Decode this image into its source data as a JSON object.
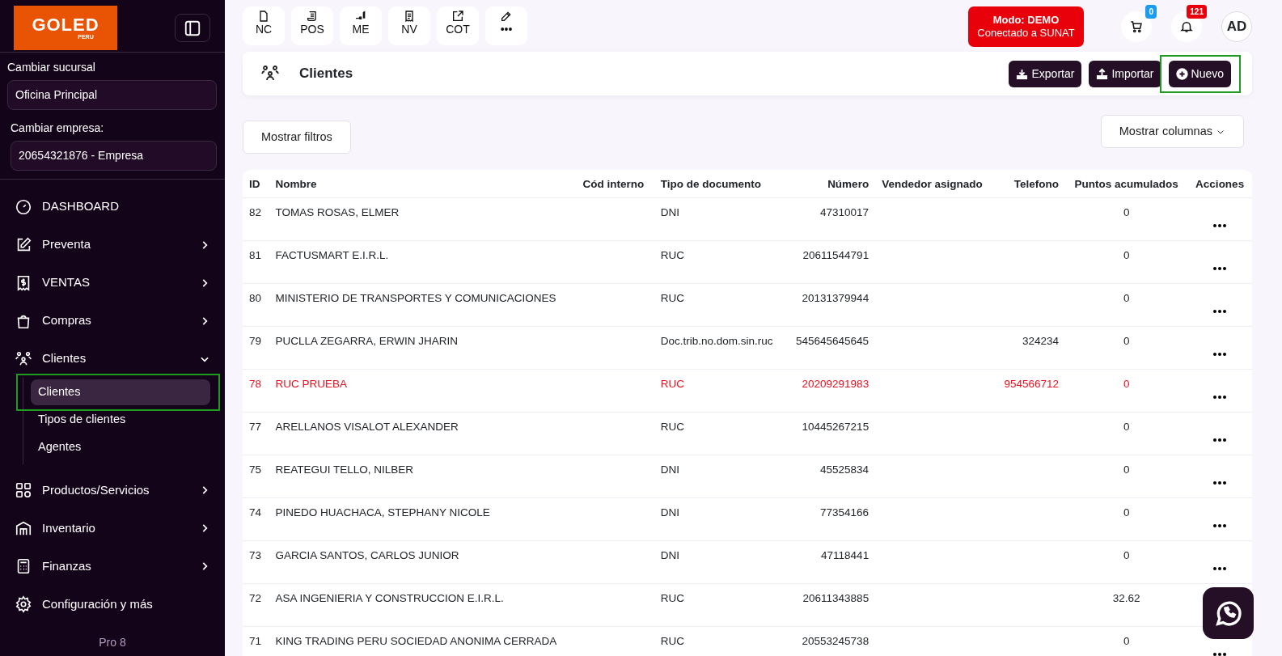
{
  "sidebar": {
    "logo": "GOLED",
    "logo_sub": "PERU",
    "branch_label": "Cambiar sucursal",
    "branch": "Oficina Principal",
    "company_label": "Cambiar empresa:",
    "company": "20654321876 - Empresa",
    "menu": [
      {
        "label": "DASHBOARD",
        "kind": "link"
      },
      {
        "label": "Preventa",
        "kind": "group",
        "expanded": false
      },
      {
        "label": "VENTAS",
        "kind": "group",
        "expanded": false
      },
      {
        "label": "Compras",
        "kind": "group",
        "expanded": false
      },
      {
        "label": "Clientes",
        "kind": "group",
        "expanded": true,
        "children": [
          {
            "label": "Clientes",
            "selected": true,
            "highlighted": true
          },
          {
            "label": "Tipos de clientes",
            "selected": false,
            "highlighted": false
          },
          {
            "label": "Agentes",
            "selected": false,
            "highlighted": false
          }
        ]
      },
      {
        "label": "Productos/Servicios",
        "kind": "group",
        "expanded": false
      },
      {
        "label": "Inventario",
        "kind": "group",
        "expanded": false
      },
      {
        "label": "Finanzas",
        "kind": "group",
        "expanded": false
      },
      {
        "label": "Configuración y más",
        "kind": "link"
      }
    ],
    "version": "Pro 8"
  },
  "quick_actions": [
    {
      "label": "NC"
    },
    {
      "label": "POS"
    },
    {
      "label": "ME"
    },
    {
      "label": "NV"
    },
    {
      "label": "COT"
    },
    {
      "label": "•••"
    }
  ],
  "mode_badge": {
    "title": "Modo: DEMO",
    "subtitle": "Conectado a SUNAT"
  },
  "cart_count": "0",
  "notification_count": "121",
  "avatar": "AD",
  "page_title": "Clientes",
  "header_buttons": [
    {
      "label": "Exportar",
      "highlighted": false
    },
    {
      "label": "Importar",
      "highlighted": false
    },
    {
      "label": "Nuevo",
      "highlighted": true
    }
  ],
  "filters_button": "Mostrar filtros",
  "columns_button": "Mostrar columnas",
  "table": {
    "columns": [
      "ID",
      "Nombre",
      "Cód interno",
      "Tipo de documento",
      "Número",
      "Vendedor asignado",
      "Telefono",
      "Puntos acumulados",
      "Acciones"
    ],
    "rows": [
      {
        "id": "82",
        "name": "TOMAS ROSAS, ELMER",
        "doc_type": "DNI",
        "number": "47310017",
        "points": "0",
        "color": "#212529"
      },
      {
        "id": "81",
        "name": "FACTUSMART E.I.R.L.",
        "doc_type": "RUC",
        "number": "20611544791",
        "points": "0",
        "color": "#212529"
      },
      {
        "id": "80",
        "name": "MINISTERIO DE TRANSPORTES Y COMUNICACIONES",
        "doc_type": "RUC",
        "number": "20131379944",
        "points": "0",
        "color": "#212529"
      },
      {
        "id": "79",
        "name": "PUCLLA ZEGARRA, ERWIN JHARIN",
        "doc_type": "Doc.trib.no.dom.sin.ruc",
        "number": "545645645645",
        "phone": "324234",
        "points": "0",
        "color": "#212529"
      },
      {
        "id": "78",
        "name": "RUC PRUEBA",
        "doc_type": "RUC",
        "number": "20209291983",
        "phone": "954566712",
        "points": "0",
        "color": "#e8101e"
      },
      {
        "id": "77",
        "name": "ARELLANOS VISALOT ALEXANDER",
        "doc_type": "RUC",
        "number": "10445267215",
        "points": "0",
        "color": "#212529"
      },
      {
        "id": "75",
        "name": "REATEGUI TELLO, NILBER",
        "doc_type": "DNI",
        "number": "45525834",
        "points": "0",
        "color": "#212529"
      },
      {
        "id": "74",
        "name": "PINEDO HUACHACA, STEPHANY NICOLE",
        "doc_type": "DNI",
        "number": "77354166",
        "points": "0",
        "color": "#212529"
      },
      {
        "id": "73",
        "name": "GARCIA SANTOS, CARLOS JUNIOR",
        "doc_type": "DNI",
        "number": "47118441",
        "points": "0",
        "color": "#212529"
      },
      {
        "id": "72",
        "name": "ASA INGENIERIA Y CONSTRUCCION E.I.R.L.",
        "doc_type": "RUC",
        "number": "20611343885",
        "points": "32.62",
        "color": "#212529"
      },
      {
        "id": "71",
        "name": "KING TRADING PERU SOCIEDAD ANONIMA CERRADA",
        "doc_type": "RUC",
        "number": "20553245738",
        "points": "0",
        "color": "#212529"
      }
    ]
  }
}
